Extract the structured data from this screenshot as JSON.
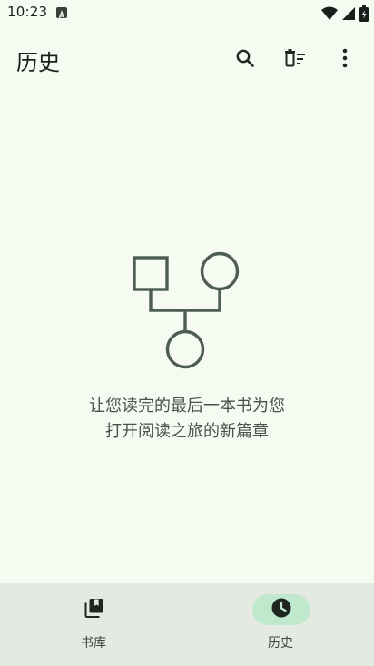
{
  "status_bar": {
    "time": "10:23",
    "badge_icon": "a-letter-icon",
    "icons": [
      "wifi-icon",
      "cell-signal-icon",
      "battery-icon"
    ]
  },
  "app_bar": {
    "title": "历史",
    "actions": [
      "search-icon",
      "delete-sweep-icon",
      "more-vert-icon"
    ]
  },
  "empty_state": {
    "illustration": "family-tree-icon",
    "line1": "让您读完的最后一本书为您",
    "line2": "打开阅读之旅的新篇章"
  },
  "bottom_nav": {
    "items": [
      {
        "label": "书库",
        "icon": "library-icon",
        "active": false
      },
      {
        "label": "历史",
        "icon": "history-icon",
        "active": true
      }
    ]
  },
  "colors": {
    "background": "#f6fbf2",
    "nav_background": "#e4eae1",
    "active_pill": "#bfe8cd",
    "icon_dark": "#1f2622",
    "illustration": "#4d5d53"
  }
}
